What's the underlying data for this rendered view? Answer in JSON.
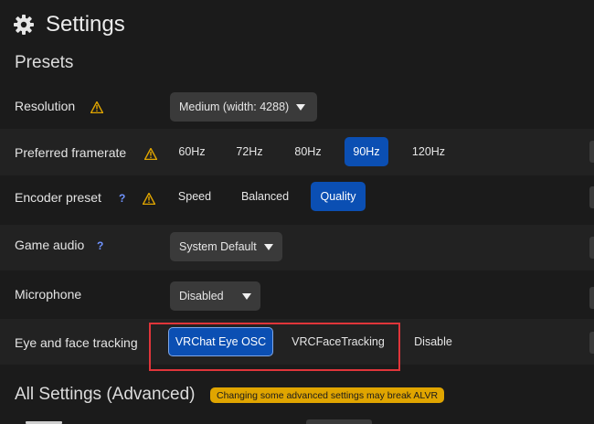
{
  "header": {
    "title": "Settings",
    "icon": "gear-icon"
  },
  "presets": {
    "heading": "Presets"
  },
  "rows": {
    "resolution": {
      "label": "Resolution",
      "value": "Medium (width: 4288)"
    },
    "framerate": {
      "label": "Preferred framerate",
      "options": [
        "60Hz",
        "72Hz",
        "80Hz",
        "90Hz",
        "120Hz"
      ],
      "selected": "90Hz"
    },
    "encoder": {
      "label": "Encoder preset",
      "help": "?",
      "options": [
        "Speed",
        "Balanced",
        "Quality"
      ],
      "selected": "Quality"
    },
    "audio": {
      "label": "Game audio",
      "help": "?",
      "value": "System Default"
    },
    "microphone": {
      "label": "Microphone",
      "value": "Disabled"
    },
    "tracking": {
      "label": "Eye and face tracking",
      "options": [
        "VRChat Eye OSC",
        "VRCFaceTracking",
        "Disable"
      ],
      "selected": "VRChat Eye OSC"
    }
  },
  "advanced": {
    "heading": "All Settings (Advanced)",
    "warning": "Changing some advanced settings may break ALVR"
  },
  "colors": {
    "accent": "#0b4fb3",
    "warning": "#e0a500",
    "highlight": "#e0353a",
    "help": "#6f93ff"
  }
}
